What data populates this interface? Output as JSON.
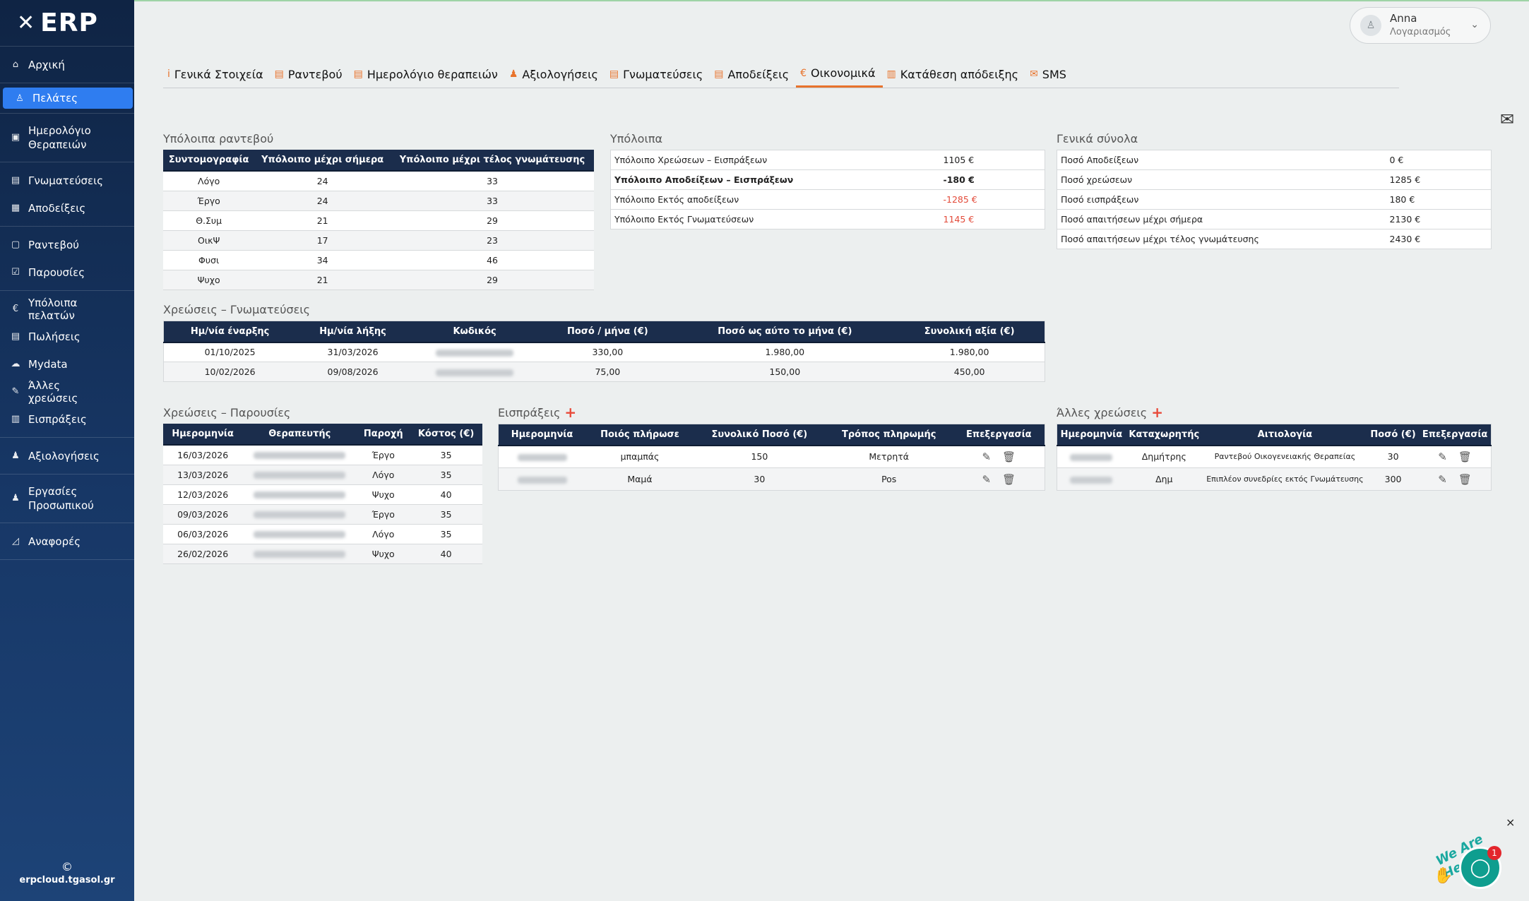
{
  "logo": "ERP",
  "sidebar": {
    "groups": [
      [
        {
          "icon": "⌂",
          "label": "Αρχική"
        }
      ],
      [
        {
          "icon": "♙",
          "label": "Πελάτες",
          "active": true
        }
      ],
      [
        {
          "icon": "▣",
          "label": "Ημερολόγιο Θεραπειών",
          "tall": true
        }
      ],
      [
        {
          "icon": "▤",
          "label": "Γνωματεύσεις"
        },
        {
          "icon": "▦",
          "label": "Αποδείξεις"
        }
      ],
      [
        {
          "icon": "▢",
          "label": "Ραντεβού"
        },
        {
          "icon": "☑",
          "label": "Παρουσίες"
        }
      ],
      [
        {
          "icon": "€",
          "label": "Υπόλοιπα πελατών"
        },
        {
          "icon": "▤",
          "label": "Πωλήσεις"
        },
        {
          "icon": "☁",
          "label": "Mydata"
        },
        {
          "icon": "✎",
          "label": "Άλλες χρεώσεις"
        },
        {
          "icon": "▥",
          "label": "Εισπράξεις"
        }
      ],
      [
        {
          "icon": "♟",
          "label": "Αξιολογήσεις"
        }
      ],
      [
        {
          "icon": "♟",
          "label": "Εργασίες Προσωπικού",
          "tall": true
        }
      ],
      [
        {
          "icon": "◿",
          "label": "Αναφορές"
        }
      ]
    ],
    "footer_copy": "©",
    "footer_site": "erpcloud.tgasol.gr"
  },
  "account": {
    "name": "Anna",
    "subtitle": "Λογαριασμός"
  },
  "tabs": [
    {
      "icon": "i",
      "label": "Γενικά Στοιχεία"
    },
    {
      "icon": "▤",
      "label": "Ραντεβού"
    },
    {
      "icon": "▤",
      "label": "Ημερολόγιο θεραπειών"
    },
    {
      "icon": "♟",
      "label": "Αξιολογήσεις"
    },
    {
      "icon": "▤",
      "label": "Γνωματεύσεις"
    },
    {
      "icon": "▤",
      "label": "Αποδείξεις"
    },
    {
      "icon": "€",
      "label": "Οικονομικά",
      "active": true
    },
    {
      "icon": "▥",
      "label": "Κατάθεση απόδειξης"
    },
    {
      "icon": "✉",
      "label": "SMS"
    }
  ],
  "appointments": {
    "title": "Υπόλοιπα ραντεβού",
    "headers": [
      "Συντομογραφία",
      "Υπόλοιπο μέχρι σήμερα",
      "Υπόλοιπο μέχρι τέλος γνωμάτευσης"
    ],
    "rows": [
      [
        "Λόγο",
        "24",
        "33"
      ],
      [
        "Έργο",
        "24",
        "33"
      ],
      [
        "Θ.Συμ",
        "21",
        "29"
      ],
      [
        "ΟικΨ",
        "17",
        "23"
      ],
      [
        "Φυσι",
        "34",
        "46"
      ],
      [
        "Ψυχο",
        "21",
        "29"
      ]
    ]
  },
  "balances": {
    "title": "Υπόλοιπα",
    "rows": [
      {
        "label": "Υπόλοιπο Χρεώσεων – Εισπράξεων",
        "value": "1105 €",
        "bold": false,
        "red": false
      },
      {
        "label": "Υπόλοιπο Αποδείξεων – Εισπράξεων",
        "value": "-180 €",
        "bold": true,
        "red": false
      },
      {
        "label": "Υπόλοιπο Εκτός αποδείξεων",
        "value": "-1285 €",
        "bold": false,
        "red": true
      },
      {
        "label": "Υπόλοιπο Εκτός Γνωματεύσεων",
        "value": "1145 €",
        "bold": false,
        "red": true
      }
    ]
  },
  "totals": {
    "title": "Γενικά σύνολα",
    "rows": [
      {
        "label": "Ποσό Αποδείξεων",
        "value": "0 €"
      },
      {
        "label": "Ποσό χρεώσεων",
        "value": "1285 €"
      },
      {
        "label": "Ποσό εισπράξεων",
        "value": "180 €"
      },
      {
        "label": "Ποσό απαιτήσεων μέχρι σήμερα",
        "value": "2130 €"
      },
      {
        "label": "Ποσό απαιτήσεων μέχρι τέλος γνωμάτευσης",
        "value": "2430 €"
      }
    ]
  },
  "referrals": {
    "title": "Χρεώσεις – Γνωματεύσεις",
    "headers": [
      "Ημ/νία έναρξης",
      "Ημ/νία λήξης",
      "Κωδικός",
      "Ποσό / μήνα (€)",
      "Ποσό ως αύτο το μήνα (€)",
      "Συνολική αξία (€)"
    ],
    "rows": [
      [
        "01/10/2025",
        "31/03/2026",
        "",
        "330,00",
        "1.980,00",
        "1.980,00"
      ],
      [
        "10/02/2026",
        "09/08/2026",
        "",
        "75,00",
        "150,00",
        "450,00"
      ]
    ]
  },
  "attendance": {
    "title": "Χρεώσεις – Παρουσίες",
    "headers": [
      "Ημερομηνία",
      "Θεραπευτής",
      "Παροχή",
      "Κόστος (€)"
    ],
    "rows": [
      [
        "16/03/2026",
        "",
        "Έργο",
        "35"
      ],
      [
        "13/03/2026",
        "",
        "Λόγο",
        "35"
      ],
      [
        "12/03/2026",
        "",
        "Ψυχο",
        "40"
      ],
      [
        "09/03/2026",
        "",
        "Έργο",
        "35"
      ],
      [
        "06/03/2026",
        "",
        "Λόγο",
        "35"
      ],
      [
        "26/02/2026",
        "",
        "Ψυχο",
        "40"
      ]
    ]
  },
  "receipts": {
    "title": "Εισπράξεις",
    "headers": [
      "Ημερομηνία",
      "Ποιός πλήρωσε",
      "Συνολικό Ποσό (€)",
      "Τρόπος πληρωμής",
      "Επεξεργασία"
    ],
    "rows": [
      [
        "",
        "μπαμπάς",
        "150",
        "Μετρητά"
      ],
      [
        "",
        "Μαμά",
        "30",
        "Pos"
      ]
    ]
  },
  "other_charges": {
    "title": "Άλλες χρεώσεις",
    "headers": [
      "Ημερομηνία",
      "Καταχωρητής",
      "Αιτιολογία",
      "Ποσό (€)",
      "Επεξεργασία"
    ],
    "rows": [
      [
        "",
        "Δημήτρης",
        "Ραντεβού Οικογενειακής Θεραπείας",
        "30"
      ],
      [
        "",
        "Δημ",
        "Επιπλέον συνεδρίες εκτός Γνωμάτευσης",
        "300"
      ]
    ]
  },
  "chat": {
    "label": "We Are Here!",
    "badge": "1",
    "close": "×"
  },
  "colors": {
    "accent": "#e8732c",
    "header_bg": "#1b2d4c",
    "active_nav": "#2f7df0",
    "negative": "#e34b3a"
  }
}
